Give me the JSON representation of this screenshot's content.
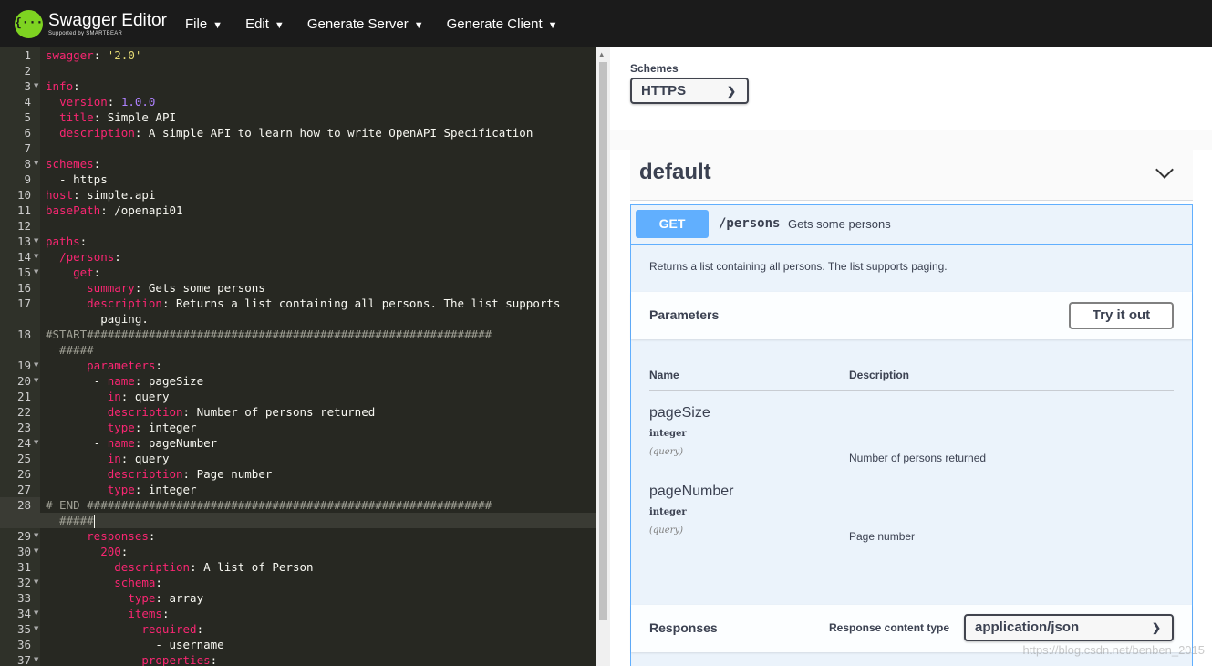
{
  "brand": {
    "name": "Swagger Editor",
    "sub": "Supported by SMARTBEAR",
    "logo_glyph": "{···}",
    "accent": "#7ed321"
  },
  "menu": [
    {
      "label": "File",
      "caret": "▼"
    },
    {
      "label": "Edit",
      "caret": "▼"
    },
    {
      "label": "Generate Server",
      "caret": "▼"
    },
    {
      "label": "Generate Client",
      "caret": "▼"
    }
  ],
  "editor": {
    "lines": [
      {
        "n": "1",
        "fold": false,
        "spans": [
          {
            "t": "k",
            "v": "swagger"
          },
          {
            "t": "p",
            "v": ": "
          },
          {
            "t": "s",
            "v": "'2.0'"
          }
        ]
      },
      {
        "n": "2",
        "fold": false,
        "spans": []
      },
      {
        "n": "3",
        "fold": true,
        "spans": [
          {
            "t": "k",
            "v": "info"
          },
          {
            "t": "p",
            "v": ":"
          }
        ]
      },
      {
        "n": "4",
        "fold": false,
        "spans": [
          {
            "t": "p",
            "v": "  "
          },
          {
            "t": "k",
            "v": "version"
          },
          {
            "t": "p",
            "v": ": "
          },
          {
            "t": "n",
            "v": "1.0.0"
          }
        ]
      },
      {
        "n": "5",
        "fold": false,
        "spans": [
          {
            "t": "p",
            "v": "  "
          },
          {
            "t": "k",
            "v": "title"
          },
          {
            "t": "p",
            "v": ": Simple API"
          }
        ]
      },
      {
        "n": "6",
        "fold": false,
        "spans": [
          {
            "t": "p",
            "v": "  "
          },
          {
            "t": "k",
            "v": "description"
          },
          {
            "t": "p",
            "v": ": A simple API to learn how to write OpenAPI Specification"
          }
        ]
      },
      {
        "n": "7",
        "fold": false,
        "spans": []
      },
      {
        "n": "8",
        "fold": true,
        "spans": [
          {
            "t": "k",
            "v": "schemes"
          },
          {
            "t": "p",
            "v": ":"
          }
        ]
      },
      {
        "n": "9",
        "fold": false,
        "spans": [
          {
            "t": "p",
            "v": "  - https"
          }
        ]
      },
      {
        "n": "10",
        "fold": false,
        "spans": [
          {
            "t": "k",
            "v": "host"
          },
          {
            "t": "p",
            "v": ": simple.api"
          }
        ]
      },
      {
        "n": "11",
        "fold": false,
        "spans": [
          {
            "t": "k",
            "v": "basePath"
          },
          {
            "t": "p",
            "v": ": /openapi01"
          }
        ]
      },
      {
        "n": "12",
        "fold": false,
        "spans": []
      },
      {
        "n": "13",
        "fold": true,
        "spans": [
          {
            "t": "k",
            "v": "paths"
          },
          {
            "t": "p",
            "v": ":"
          }
        ]
      },
      {
        "n": "14",
        "fold": true,
        "spans": [
          {
            "t": "p",
            "v": "  "
          },
          {
            "t": "k",
            "v": "/persons"
          },
          {
            "t": "p",
            "v": ":"
          }
        ]
      },
      {
        "n": "15",
        "fold": true,
        "spans": [
          {
            "t": "p",
            "v": "    "
          },
          {
            "t": "k",
            "v": "get"
          },
          {
            "t": "p",
            "v": ":"
          }
        ]
      },
      {
        "n": "16",
        "fold": false,
        "spans": [
          {
            "t": "p",
            "v": "      "
          },
          {
            "t": "k",
            "v": "summary"
          },
          {
            "t": "p",
            "v": ": Gets some persons"
          }
        ]
      },
      {
        "n": "17",
        "fold": false,
        "spans": [
          {
            "t": "p",
            "v": "      "
          },
          {
            "t": "k",
            "v": "description"
          },
          {
            "t": "p",
            "v": ": Returns a list containing all persons. The list supports"
          }
        ]
      },
      {
        "n": "",
        "fold": false,
        "spans": [
          {
            "t": "p",
            "v": "        paging."
          }
        ]
      },
      {
        "n": "18",
        "fold": false,
        "spans": [
          {
            "t": "c",
            "v": "#START###########################################################"
          }
        ]
      },
      {
        "n": "",
        "fold": false,
        "spans": [
          {
            "t": "c",
            "v": "  #####"
          }
        ]
      },
      {
        "n": "19",
        "fold": true,
        "spans": [
          {
            "t": "p",
            "v": "      "
          },
          {
            "t": "k",
            "v": "parameters"
          },
          {
            "t": "p",
            "v": ":"
          }
        ]
      },
      {
        "n": "20",
        "fold": true,
        "spans": [
          {
            "t": "p",
            "v": "       - "
          },
          {
            "t": "k",
            "v": "name"
          },
          {
            "t": "p",
            "v": ": pageSize"
          }
        ]
      },
      {
        "n": "21",
        "fold": false,
        "spans": [
          {
            "t": "p",
            "v": "         "
          },
          {
            "t": "k",
            "v": "in"
          },
          {
            "t": "p",
            "v": ": query"
          }
        ]
      },
      {
        "n": "22",
        "fold": false,
        "spans": [
          {
            "t": "p",
            "v": "         "
          },
          {
            "t": "k",
            "v": "description"
          },
          {
            "t": "p",
            "v": ": Number of persons returned"
          }
        ]
      },
      {
        "n": "23",
        "fold": false,
        "spans": [
          {
            "t": "p",
            "v": "         "
          },
          {
            "t": "k",
            "v": "type"
          },
          {
            "t": "p",
            "v": ": integer"
          }
        ]
      },
      {
        "n": "24",
        "fold": true,
        "spans": [
          {
            "t": "p",
            "v": "       - "
          },
          {
            "t": "k",
            "v": "name"
          },
          {
            "t": "p",
            "v": ": pageNumber"
          }
        ]
      },
      {
        "n": "25",
        "fold": false,
        "spans": [
          {
            "t": "p",
            "v": "         "
          },
          {
            "t": "k",
            "v": "in"
          },
          {
            "t": "p",
            "v": ": query"
          }
        ]
      },
      {
        "n": "26",
        "fold": false,
        "spans": [
          {
            "t": "p",
            "v": "         "
          },
          {
            "t": "k",
            "v": "description"
          },
          {
            "t": "p",
            "v": ": Page number"
          }
        ]
      },
      {
        "n": "27",
        "fold": false,
        "spans": [
          {
            "t": "p",
            "v": "         "
          },
          {
            "t": "k",
            "v": "type"
          },
          {
            "t": "p",
            "v": ": integer"
          }
        ]
      },
      {
        "n": "28",
        "fold": false,
        "spans": [
          {
            "t": "c",
            "v": "# END ###########################################################"
          }
        ]
      },
      {
        "n": "",
        "fold": false,
        "cursor": true,
        "spans": [
          {
            "t": "c",
            "v": "  #####"
          }
        ]
      },
      {
        "n": "29",
        "fold": true,
        "spans": [
          {
            "t": "p",
            "v": "      "
          },
          {
            "t": "k",
            "v": "responses"
          },
          {
            "t": "p",
            "v": ":"
          }
        ]
      },
      {
        "n": "30",
        "fold": true,
        "spans": [
          {
            "t": "p",
            "v": "        "
          },
          {
            "t": "k",
            "v": "200"
          },
          {
            "t": "p",
            "v": ":"
          }
        ]
      },
      {
        "n": "31",
        "fold": false,
        "spans": [
          {
            "t": "p",
            "v": "          "
          },
          {
            "t": "k",
            "v": "description"
          },
          {
            "t": "p",
            "v": ": A list of Person"
          }
        ]
      },
      {
        "n": "32",
        "fold": true,
        "spans": [
          {
            "t": "p",
            "v": "          "
          },
          {
            "t": "k",
            "v": "schema"
          },
          {
            "t": "p",
            "v": ":"
          }
        ]
      },
      {
        "n": "33",
        "fold": false,
        "spans": [
          {
            "t": "p",
            "v": "            "
          },
          {
            "t": "k",
            "v": "type"
          },
          {
            "t": "p",
            "v": ": array"
          }
        ]
      },
      {
        "n": "34",
        "fold": true,
        "spans": [
          {
            "t": "p",
            "v": "            "
          },
          {
            "t": "k",
            "v": "items"
          },
          {
            "t": "p",
            "v": ":"
          }
        ]
      },
      {
        "n": "35",
        "fold": true,
        "spans": [
          {
            "t": "p",
            "v": "              "
          },
          {
            "t": "k",
            "v": "required"
          },
          {
            "t": "p",
            "v": ":"
          }
        ]
      },
      {
        "n": "36",
        "fold": false,
        "spans": [
          {
            "t": "p",
            "v": "                - username"
          }
        ]
      },
      {
        "n": "37",
        "fold": true,
        "spans": [
          {
            "t": "p",
            "v": "              "
          },
          {
            "t": "k",
            "v": "properties"
          },
          {
            "t": "p",
            "v": ":"
          }
        ]
      }
    ],
    "colors": {
      "background": "#272822",
      "key": "#f92672",
      "string": "#e6db74",
      "number": "#ae81ff",
      "comment": "#9f9f94"
    }
  },
  "ui": {
    "schemes_label": "Schemes",
    "schemes_value": "HTTPS",
    "tag_title": "default",
    "operation": {
      "method": "GET",
      "path": "/persons",
      "summary": "Gets some persons",
      "description": "Returns a list containing all persons. The list supports paging."
    },
    "parameters": {
      "title": "Parameters",
      "try_label": "Try it out",
      "col_name": "Name",
      "col_desc": "Description",
      "items": [
        {
          "name": "pageSize",
          "type": "integer",
          "in": "(query)",
          "desc": "Number of persons returned"
        },
        {
          "name": "pageNumber",
          "type": "integer",
          "in": "(query)",
          "desc": "Page number"
        }
      ]
    },
    "responses": {
      "title": "Responses",
      "content_type_label": "Response content type",
      "content_type_value": "application/json"
    },
    "watermark": "https://blog.csdn.net/benben_2015",
    "colors": {
      "get": "#61affe",
      "op_bg": "#ebf3fb",
      "text": "#3b4151"
    }
  }
}
